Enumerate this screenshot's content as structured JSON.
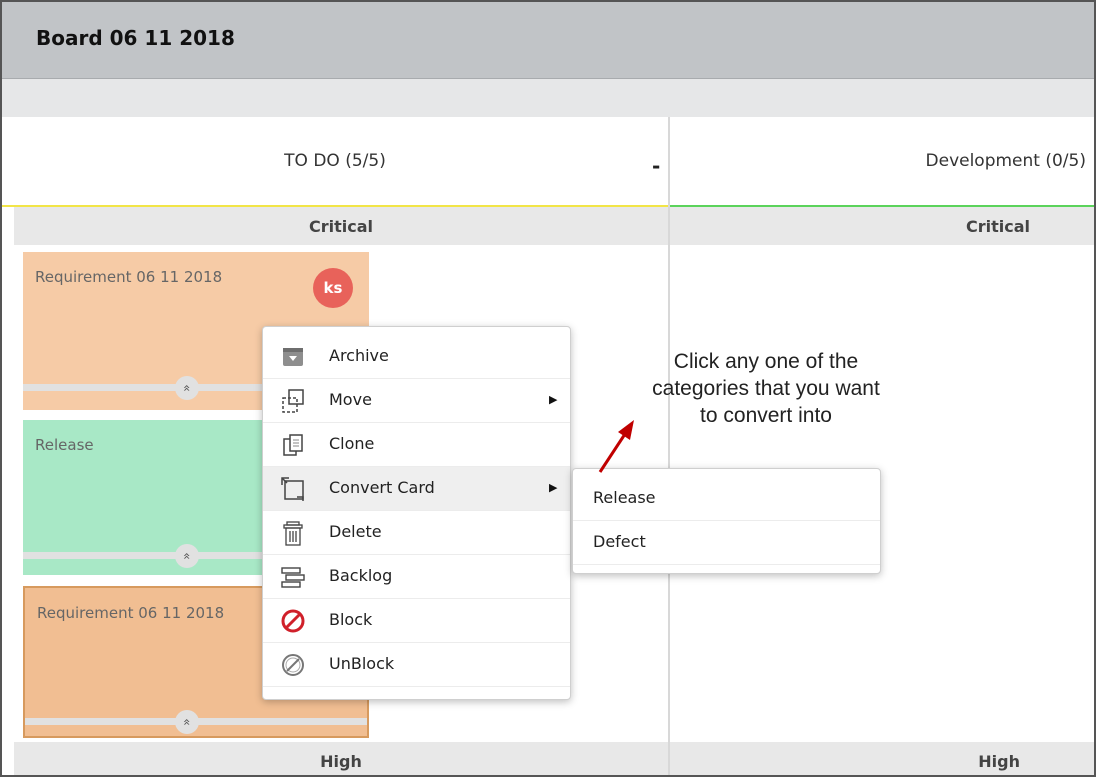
{
  "board": {
    "title": "Board 06 11 2018"
  },
  "columns": [
    {
      "label": "TO DO (5/5)",
      "accent": "#f2e547"
    },
    {
      "label": "Development (0/5)",
      "accent": "#5bd35b"
    }
  ],
  "collapse_symbol": "-",
  "lanes": {
    "critical": "Critical",
    "high": "High"
  },
  "cards": [
    {
      "title": "Requirement 06 11 2018",
      "color": "#f6cba6",
      "assignee": "ks",
      "toggle_icon": "double-chevron-up-icon"
    },
    {
      "title": "Release",
      "color": "#a8e8c6",
      "toggle_icon": "double-chevron-up-icon"
    },
    {
      "title": "Requirement 06 11 2018",
      "color": "#f1be92",
      "toggle_icon": "double-chevron-up-icon"
    }
  ],
  "toggle_glyph": "«",
  "context_menu": {
    "items": [
      {
        "label": "Archive",
        "icon": "archive-icon"
      },
      {
        "label": "Move",
        "icon": "move-icon",
        "has_submenu": true
      },
      {
        "label": "Clone",
        "icon": "clone-icon"
      },
      {
        "label": "Convert Card",
        "icon": "convert-card-icon",
        "has_submenu": true,
        "active": true
      },
      {
        "label": "Delete",
        "icon": "trash-icon"
      },
      {
        "label": "Backlog",
        "icon": "backlog-icon"
      },
      {
        "label": "Block",
        "icon": "block-icon"
      },
      {
        "label": "UnBlock",
        "icon": "unblock-icon"
      }
    ],
    "submenu_arrow": "▶"
  },
  "convert_submenu": {
    "items": [
      {
        "label": "Release"
      },
      {
        "label": "Defect"
      }
    ]
  },
  "annotation": {
    "text": "Click any one of the categories that you want to convert into",
    "arrow_color": "#c00000"
  }
}
